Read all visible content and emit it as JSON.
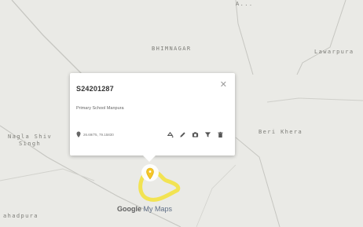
{
  "map": {
    "places": {
      "top_partial": "A...",
      "bhimnagar": "BHIMNAGAR",
      "lawarpura": "Lawarpura",
      "nagla_shiv_singh": "Nagla Shiv\nSingh",
      "beri_khera": "Beri Khera",
      "bottom_left": "ahadpura"
    },
    "colors": {
      "background": "#eaeae6",
      "road": "#c9c9c4",
      "route": "#f2e34a",
      "marker": "#f5c527"
    }
  },
  "popup": {
    "title": "S24201287",
    "description": "Primary School Manpura",
    "coordinates": "26.69/75, 79.15830",
    "close_icon": "close-icon",
    "tools": [
      "style-icon",
      "edit-icon",
      "camera-icon",
      "filter-icon",
      "delete-icon"
    ]
  },
  "branding": {
    "google": "Google",
    "my_maps": "My Maps"
  }
}
